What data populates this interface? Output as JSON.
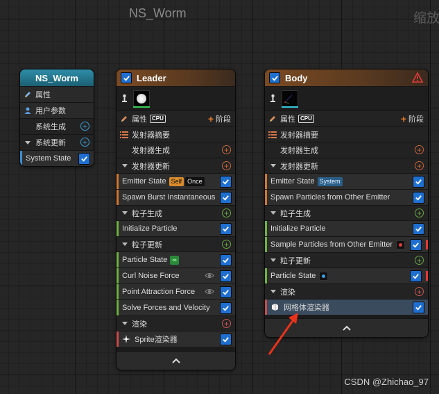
{
  "graph": {
    "title": "NS_Worm",
    "right_label": "缩放",
    "watermark": "CSDN @Zhichao_97"
  },
  "system_node": {
    "title": "NS_Worm",
    "items": [
      {
        "label": "属性"
      },
      {
        "label": "用户参数"
      },
      {
        "label": "系统生成"
      },
      {
        "label": "系统更新"
      }
    ],
    "system_state": {
      "label": "System State",
      "checked": true
    }
  },
  "leader_node": {
    "title": "Leader",
    "enabled": true,
    "properties_label": "属性",
    "sim_target": "CPU",
    "stage_label": "阶段",
    "summary_label": "发射器摘要",
    "emitter_spawn_label": "发射器生成",
    "emitter_update_label": "发射器更新",
    "emitter_update_modules": [
      {
        "label": "Emitter State",
        "badges": [
          "Self",
          "Once"
        ]
      },
      {
        "label": "Spawn Burst Instantaneous"
      }
    ],
    "particle_spawn_label": "粒子生成",
    "particle_spawn_modules": [
      {
        "label": "Initialize Particle"
      }
    ],
    "particle_update_label": "粒子更新",
    "particle_update_modules": [
      {
        "label": "Particle State",
        "badge": "∞"
      },
      {
        "label": "Curl Noise Force"
      },
      {
        "label": "Point Attraction Force"
      },
      {
        "label": "Solve Forces and Velocity"
      }
    ],
    "render_label": "渲染",
    "renderers": [
      {
        "label": "Sprite渲染器"
      }
    ]
  },
  "body_node": {
    "title": "Body",
    "enabled": true,
    "properties_label": "属性",
    "sim_target": "CPU",
    "stage_label": "阶段",
    "summary_label": "发射器摘要",
    "emitter_spawn_label": "发射器生成",
    "emitter_update_label": "发射器更新",
    "emitter_update_modules": [
      {
        "label": "Emitter State",
        "badge": "System"
      },
      {
        "label": "Spawn Particles from Other Emitter"
      }
    ],
    "particle_spawn_label": "粒子生成",
    "particle_spawn_modules": [
      {
        "label": "Initialize Particle"
      },
      {
        "label": "Sample Particles from Other Emitter"
      }
    ],
    "particle_update_label": "粒子更新",
    "particle_update_modules": [
      {
        "label": "Particle State"
      }
    ],
    "render_label": "渲染",
    "renderers": [
      {
        "label": "网格体渲染器"
      }
    ]
  },
  "colors": {
    "accent_blue": "#1f6fd1",
    "emitter_spawn": "#d1772e",
    "particle_green": "#6db33f",
    "render_red": "#c94b4b",
    "annotation_arrow": "#e8331c"
  },
  "icons": {
    "check": "checkmark-icon",
    "warning": "warning-triangle-icon",
    "pencil": "pencil-icon",
    "user": "user-icon",
    "plus": "plus-circle-icon",
    "eye": "eye-icon",
    "collapse": "chevron-up-icon"
  }
}
